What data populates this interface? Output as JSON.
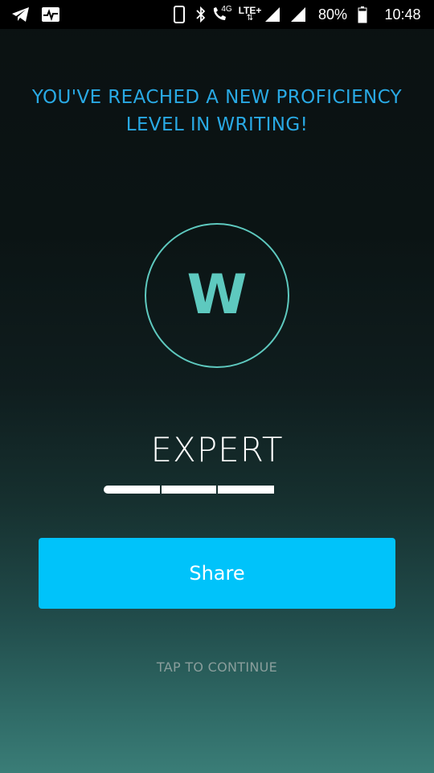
{
  "status_bar": {
    "icons": [
      "telegram-icon",
      "activity-monitor-icon",
      "phone-device-icon",
      "bluetooth-icon",
      "wifi-calling-icon",
      "network-type-icon",
      "lte-plus-icon",
      "signal-icon",
      "signal-icon",
      "battery-icon"
    ],
    "network_label": "4G",
    "lte_label": "LTE+",
    "battery_percent": "80%",
    "battery_level": 0.8,
    "time": "10:48"
  },
  "headline": {
    "line1": "YOU'VE REACHED A NEW PROFICIENCY",
    "line2": "LEVEL IN WRITING!"
  },
  "badge": {
    "letter": "W",
    "color": "#5ec9bf"
  },
  "level": {
    "name": "EXPERT",
    "segments_total": 3,
    "segments_filled": 3
  },
  "actions": {
    "share_label": "Share",
    "continue_label": "TAP TO CONTINUE"
  },
  "colors": {
    "accent": "#29a9e4",
    "button": "#00c3fa",
    "badge": "#5ec9bf"
  }
}
